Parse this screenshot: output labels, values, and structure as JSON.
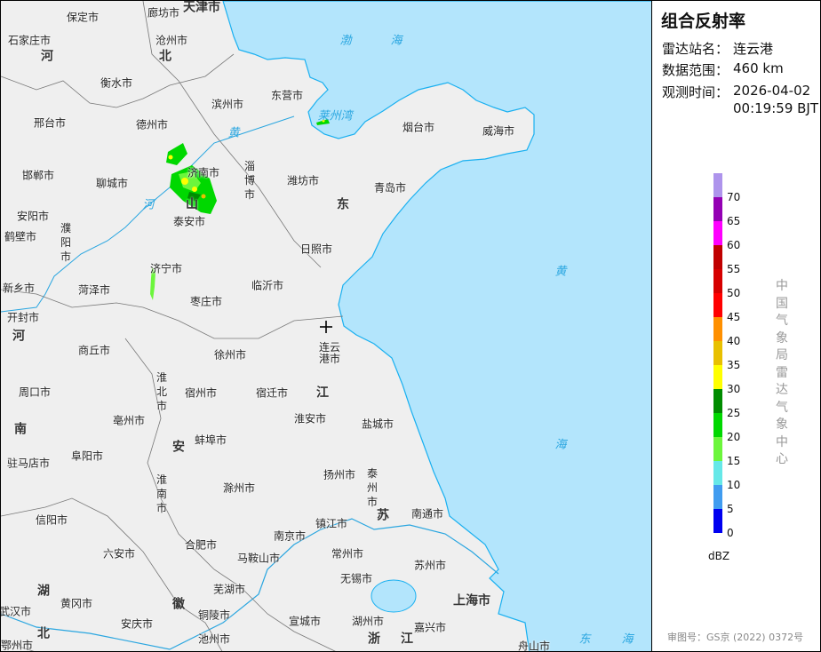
{
  "panel": {
    "title": "组合反射率",
    "station_label": "雷达站名：",
    "station": "连云港",
    "range_label": "数据范围：",
    "range": "460 km",
    "time_label": "观测时间：",
    "date": "2026-04-02",
    "time": "00:19:59 BJT",
    "unit": "dBZ",
    "org": "中国气象局雷达气象中心",
    "approval": "审图号：GS京 (2022) 0372号"
  },
  "legend": {
    "ticks": [
      "70",
      "65",
      "60",
      "55",
      "50",
      "45",
      "40",
      "35",
      "30",
      "25",
      "20",
      "15",
      "10",
      "5",
      "0"
    ],
    "colors": [
      "#ae94ec",
      "#9400b4",
      "#ff00ff",
      "#c00000",
      "#d60000",
      "#ff0000",
      "#ff9000",
      "#e8c000",
      "#ffff00",
      "#008c00",
      "#00d800",
      "#6cf63c",
      "#66e8e8",
      "#409cf0",
      "#0000f0"
    ]
  },
  "map": {
    "sea_color": "#b3e5fc",
    "land_color": "#efefef",
    "radar_site": "连云港",
    "cities": [
      "保定市",
      "廊坊市",
      "石家庄市",
      "沧州市",
      "衡水市",
      "滨州市",
      "东营市",
      "德州市",
      "邢台市",
      "济南市",
      "潍坊市",
      "烟台市",
      "威海市",
      "青岛市",
      "邯郸市",
      "聊城市",
      "泰安市",
      "安阳市",
      "鹤壁市",
      "日照市",
      "济宁市",
      "新乡市",
      "菏泽市",
      "临沂市",
      "枣庄市",
      "开封市",
      "商丘市",
      "徐州市",
      "周口市",
      "宿州市",
      "宿迁市",
      "亳州市",
      "淮安市",
      "盐城市",
      "蚌埠市",
      "驻马店市",
      "阜阳市",
      "扬州市",
      "滁州市",
      "南通市",
      "信阳市",
      "镇江市",
      "南京市",
      "六安市",
      "合肥市",
      "马鞍山市",
      "常州市",
      "苏州市",
      "无锡市",
      "芜湖市",
      "黄冈市",
      "铜陵市",
      "武汉市",
      "安庆市",
      "宣城市",
      "湖州市",
      "嘉兴市",
      "鄂州市",
      "池州市",
      "舟山市"
    ],
    "vertical_cities": [
      "淄博市",
      "濮阳市",
      "连云港市",
      "淮北市",
      "泰州市",
      "淮南市"
    ],
    "provinces": [
      "天津市",
      "河",
      "北",
      "山",
      "东",
      "河",
      "南",
      "江",
      "苏",
      "安",
      "徽",
      "湖",
      "北",
      "浙",
      "江",
      "上海市"
    ],
    "water": [
      "渤",
      "海",
      "莱州湾",
      "黄",
      "河",
      "黄",
      "海",
      "东",
      "海"
    ]
  }
}
